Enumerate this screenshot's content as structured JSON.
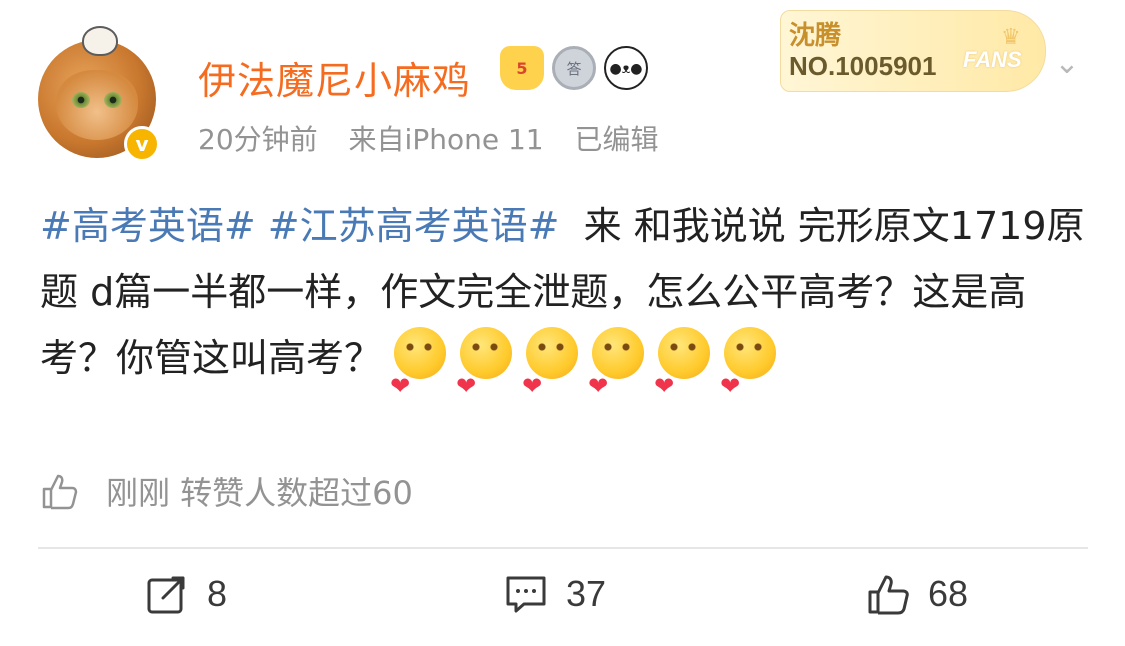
{
  "post": {
    "author": {
      "name": "伊法魔尼小麻鸡",
      "verified_label": "v",
      "badges": [
        {
          "icon": "vip-crown-icon",
          "text": "5"
        },
        {
          "icon": "medal-icon",
          "text": "答"
        },
        {
          "icon": "panda-icon",
          "text": "●ᴥ●"
        }
      ]
    },
    "meta": {
      "time": "20分钟前",
      "source": "来自iPhone 11",
      "edited": "已编辑"
    },
    "fans_card": {
      "name": "沈腾",
      "number": "NO.1005901",
      "logo": "FANS"
    },
    "content": {
      "tag1": "#高考英语#",
      "tag2": "#江苏高考英语#",
      "text": "来 和我说说 完形原文1719原题 d篇一半都一样，作文完全泄题，怎么公平高考？这是高考？你管这叫高考？",
      "emoji_count": 6,
      "emoji_icon": "shy-love-emoji-icon"
    },
    "like_note": "刚刚 转赞人数超过60",
    "actions": {
      "reposts": "8",
      "comments": "37",
      "likes": "68"
    }
  }
}
